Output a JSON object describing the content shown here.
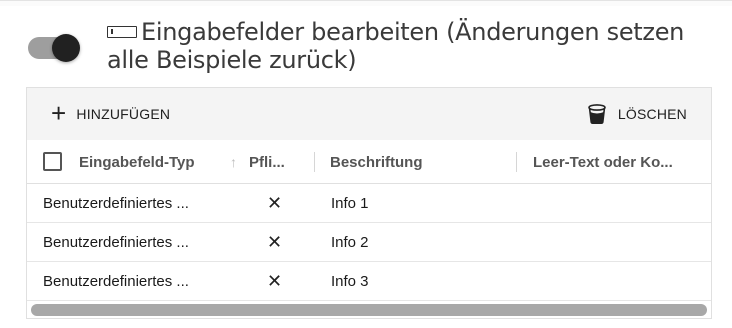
{
  "header": {
    "toggle_state": "on",
    "title": "Eingabefelder bearbeiten (Änderungen setzen alle Beispiele zurück)",
    "title_icon": "text-input-icon"
  },
  "toolbar": {
    "add_label": "HINZUFÜGEN",
    "add_icon": "plus-icon",
    "delete_label": "LÖSCHEN",
    "delete_icon": "trash-icon"
  },
  "table": {
    "columns": [
      {
        "label": "Eingabefeld-Typ",
        "sort_indicator": "↑"
      },
      {
        "label": "Pfli..."
      },
      {
        "label": "Beschriftung"
      },
      {
        "label": "Leer-Text oder Ko..."
      }
    ],
    "rows": [
      {
        "type": "Benutzerdefiniertes ...",
        "required": "✕",
        "label": "Info 1",
        "placeholder": ""
      },
      {
        "type": "Benutzerdefiniertes ...",
        "required": "✕",
        "label": "Info 2",
        "placeholder": ""
      },
      {
        "type": "Benutzerdefiniertes ...",
        "required": "✕",
        "label": "Info 3",
        "placeholder": ""
      }
    ]
  },
  "colors": {
    "toggle_thumb": "#212121",
    "toggle_track": "#9e9e9e",
    "toolbar_bg": "#f4f4f4",
    "scrollbar": "#a8a8a8"
  }
}
